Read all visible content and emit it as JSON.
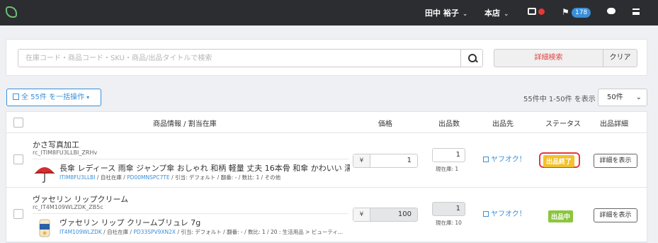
{
  "header": {
    "user": "田中 裕子",
    "store": "本店",
    "notification_count": "178"
  },
  "search": {
    "placeholder": "在庫コード・商品コード・SKU・商品/出品タイトルで検索",
    "advanced_label": "詳細検索",
    "clear_label": "クリア"
  },
  "toolbar": {
    "bulk_label": "全 55件 を一括操作",
    "range_text": "55件中 1-50件 を表示",
    "per_page": "50件"
  },
  "table": {
    "headers": [
      "商品情報 / 割当在庫",
      "価格",
      "出品数",
      "出品先",
      "ステータス",
      "出品詳細"
    ],
    "rows": [
      {
        "title": "かさ写真加工",
        "code": "rc_ITIM8FU3LLBI_ZRHv",
        "item_name": "長傘 レディース 雨傘 ジャンプ傘 おしゃれ 和柄 軽量 丈夫 16本骨 和傘 かわいい 濡れると 猫...",
        "meta_sku": "ITIM8FU3LLBI",
        "meta_mid1": " / 自社在庫 / ",
        "meta_pd": "PD00MNSPC7TE",
        "meta_rest": " / 引当: デフォルト / 翻番: - / 数比: 1 / その他",
        "price": "1",
        "qty": "1",
        "stock": "現在庫: 1",
        "channel": "ヤフオク！",
        "status": "出品終了",
        "detail": "詳細を表示"
      },
      {
        "title": "ヴァセリン リップクリーム",
        "code": "rc_IT4M109WLZDK_ZB5c",
        "item_name": "ヴァセリン リップ クリームブリュレ 7g",
        "meta_sku": "IT4M109WLZDK",
        "meta_mid1": " / 自社在庫 / ",
        "meta_pd": "PD33SPV9XN2X",
        "meta_rest": " / 引当: デフォルト / 翻番: - / 数比: 1 / 20 : 生活用品 > ビューティ...",
        "price": "100",
        "qty": "1",
        "stock": "現在庫: 10",
        "channel": "ヤフオク！",
        "status": "出品中",
        "detail": "詳細を表示"
      }
    ]
  },
  "colors": {
    "topbar": "#2b2d30",
    "accent": "#3a8fd9",
    "danger": "#e53935",
    "status_ended": "#f2c12e",
    "status_active": "#8cc63f"
  }
}
